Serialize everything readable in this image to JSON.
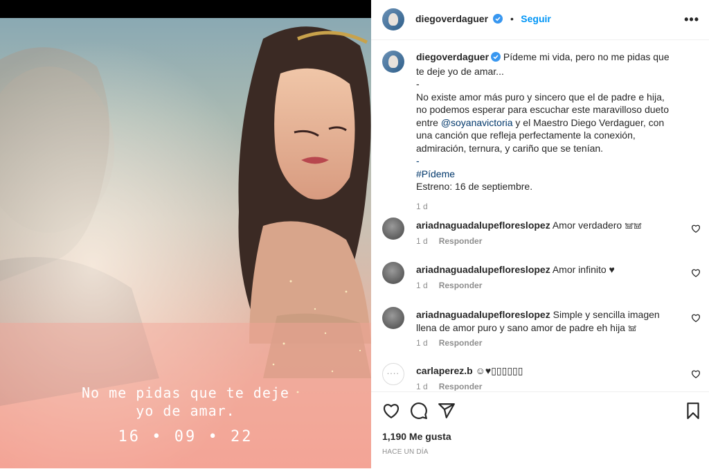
{
  "media": {
    "caption_line1": "No me pidas que te deje",
    "caption_line2": "yo de amar.",
    "date": "16 • 09 • 22"
  },
  "header": {
    "username": "diegoverdaguer",
    "separator": "•",
    "follow_label": "Seguir",
    "more_label": "•••"
  },
  "post": {
    "username": "diegoverdaguer",
    "text_intro": "Pídeme mi vida, pero no me pidas que te deje yo de amar...",
    "dash1": "-",
    "text_body_1": "No existe amor más puro y sincero que el de padre e hija, no podemos esperar para escuchar este maravilloso dueto entre ",
    "mention": "@soyanavictoria",
    "text_body_2": " y el Maestro Diego Verdaguer, con una canción que refleja perfectamente la conexión, admiración, ternura, y cariño que se tenían.",
    "dash2": "-",
    "hashtag": "#Pídeme",
    "release": "Estreno: 16 de septiembre.",
    "time": "1 d"
  },
  "comments": [
    {
      "username": "ariadnaguadalupefloreslopez",
      "text": "Amor verdadero 𖠌𖠌",
      "time": "1 d",
      "reply": "Responder"
    },
    {
      "username": "ariadnaguadalupefloreslopez",
      "text": "Amor infinito ♥",
      "time": "1 d",
      "reply": "Responder"
    },
    {
      "username": "ariadnaguadalupefloreslopez",
      "text": "Simple y sencilla imagen llena de amor puro y sano amor de padre eh hija 𖠌",
      "time": "1 d",
      "reply": "Responder"
    },
    {
      "username": "carlaperez.b",
      "text": "☺♥▯▯▯▯▯▯",
      "time": "1 d",
      "reply": "Responder"
    }
  ],
  "footer": {
    "likes": "1,190 Me gusta",
    "posted": "HACE UN DÍA"
  },
  "colors": {
    "link": "#00376b",
    "follow": "#0095f6",
    "verified": "#3897f0"
  },
  "icons": [
    "verified-badge-icon",
    "more-icon",
    "heart-icon",
    "comment-icon",
    "share-icon",
    "save-icon"
  ]
}
